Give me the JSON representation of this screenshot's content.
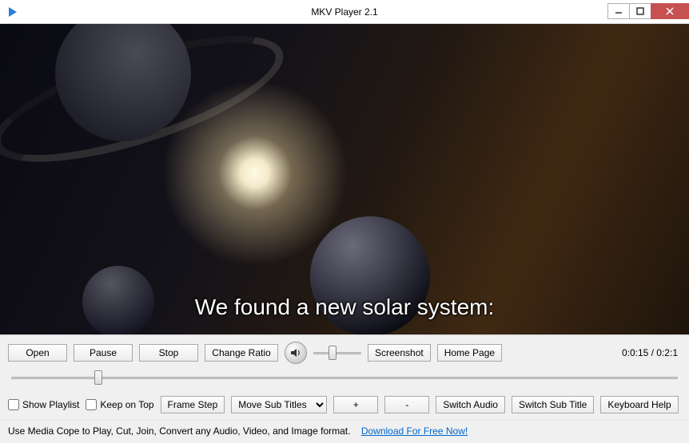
{
  "window": {
    "title": "MKV Player 2.1"
  },
  "video": {
    "subtitle": "We found a new solar system:"
  },
  "toolbar": {
    "open": "Open",
    "pause": "Pause",
    "stop": "Stop",
    "change_ratio": "Change Ratio",
    "screenshot": "Screenshot",
    "home_page": "Home Page",
    "time_current": "0:0:15",
    "time_total": "0:2:1",
    "time_display": "0:0:15 / 0:2:1"
  },
  "options": {
    "show_playlist": "Show Playlist",
    "keep_on_top": "Keep on Top",
    "frame_step": "Frame Step",
    "move_subtitles": "Move Sub Titles",
    "plus": "+",
    "minus": "-",
    "switch_audio": "Switch Audio",
    "switch_subtitle": "Switch Sub Title",
    "keyboard_help": "Keyboard Help"
  },
  "footer": {
    "text": "Use Media Cope to Play, Cut, Join, Convert any Audio, Video, and Image format.",
    "link": "Download For Free Now!"
  }
}
